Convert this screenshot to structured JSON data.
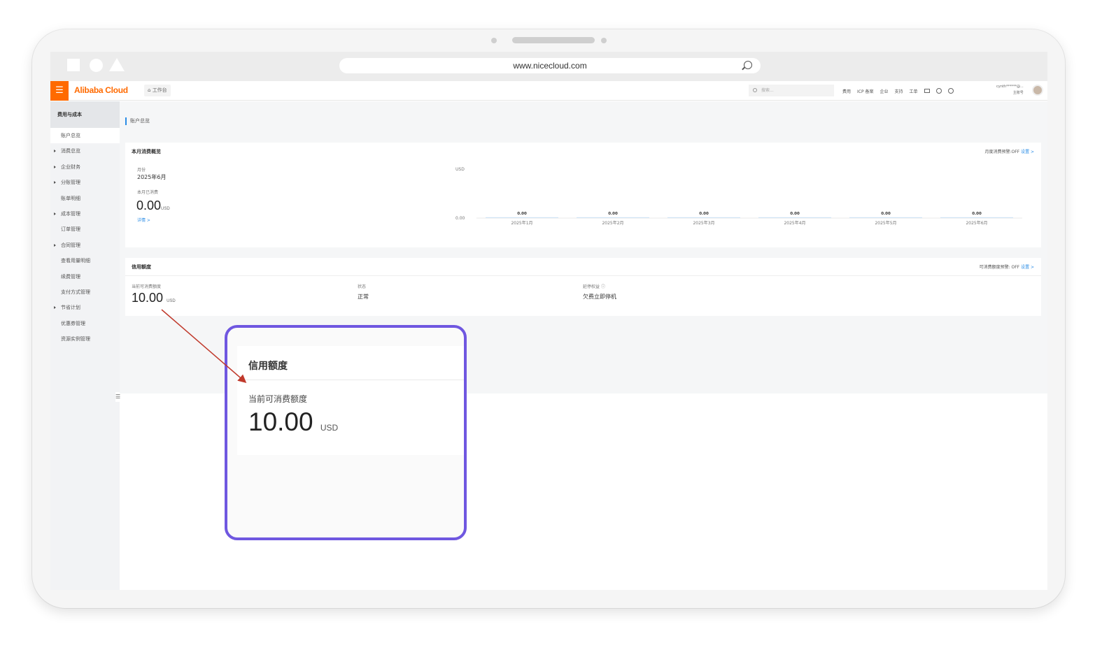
{
  "browser": {
    "url": "www.nicecloud.com"
  },
  "topnav": {
    "logo": "Alibaba Cloud",
    "workbench": "工作台",
    "search_placeholder": "搜索...",
    "links": [
      "费用",
      "ICP 备案",
      "企业",
      "支持",
      "工单"
    ],
    "user_name": "cynth******@...",
    "user_role": "主账号",
    "menu_glyph": "☰",
    "workbench_glyph": "⌂",
    "search_icon": "search-icon"
  },
  "sidebar": {
    "title": "费用与成本",
    "items": [
      {
        "label": "账户总览",
        "caret": false,
        "active": true
      },
      {
        "label": "消费总览",
        "caret": true
      },
      {
        "label": "企业财务",
        "caret": true
      },
      {
        "label": "分账管理",
        "caret": true
      },
      {
        "label": "账单明细",
        "caret": false
      },
      {
        "label": "成本管理",
        "caret": true
      },
      {
        "label": "订单管理",
        "caret": false
      },
      {
        "label": "合同管理",
        "caret": true
      },
      {
        "label": "查看用量明细",
        "caret": false
      },
      {
        "label": "续费管理",
        "caret": false
      },
      {
        "label": "支付方式管理",
        "caret": false
      },
      {
        "label": "节省计划",
        "caret": true
      },
      {
        "label": "优惠券管理",
        "caret": false
      },
      {
        "label": "资源实例管理",
        "caret": false
      }
    ],
    "toggle_glyph": "☰"
  },
  "main": {
    "breadcrumb": "账户总览",
    "monthly": {
      "title": "本月消费概览",
      "alert_label": "月度消费预警:OFF",
      "alert_link": "设置 >",
      "month_label": "月份",
      "month_value": "2025年6月",
      "spent_label": "本月已消费",
      "spent_value": "0.00",
      "spent_unit": "USD",
      "detail_link": "详情 >"
    },
    "credit": {
      "title": "信用额度",
      "alert_label": "可消费额度预警:  OFF",
      "alert_link": "设置 >",
      "available_label": "当前可消费额度",
      "available_value": "10.00",
      "available_unit": "USD",
      "status_label": "状态",
      "status_value": "正常",
      "action_label": "延停权益",
      "action_value": "欠费立即停机"
    }
  },
  "zoom": {
    "title": "信用额度",
    "label": "当前可消费额度",
    "value": "10.00",
    "unit": "USD"
  },
  "chart_data": {
    "type": "bar",
    "ylabel": "USD",
    "ytick": "0.00",
    "categories": [
      "2025年1月",
      "2025年2月",
      "2025年3月",
      "2025年4月",
      "2025年5月",
      "2025年6月"
    ],
    "values": [
      0.0,
      0.0,
      0.0,
      0.0,
      0.0,
      0.0
    ],
    "data_labels": [
      "0.00",
      "0.00",
      "0.00",
      "0.00",
      "0.00",
      "0.00"
    ],
    "ylim": [
      0,
      1
    ]
  },
  "colors": {
    "accent": "#ff6a00",
    "highlight": "#6f57e0",
    "link": "#2b8de6",
    "arrow": "#c0392b"
  }
}
